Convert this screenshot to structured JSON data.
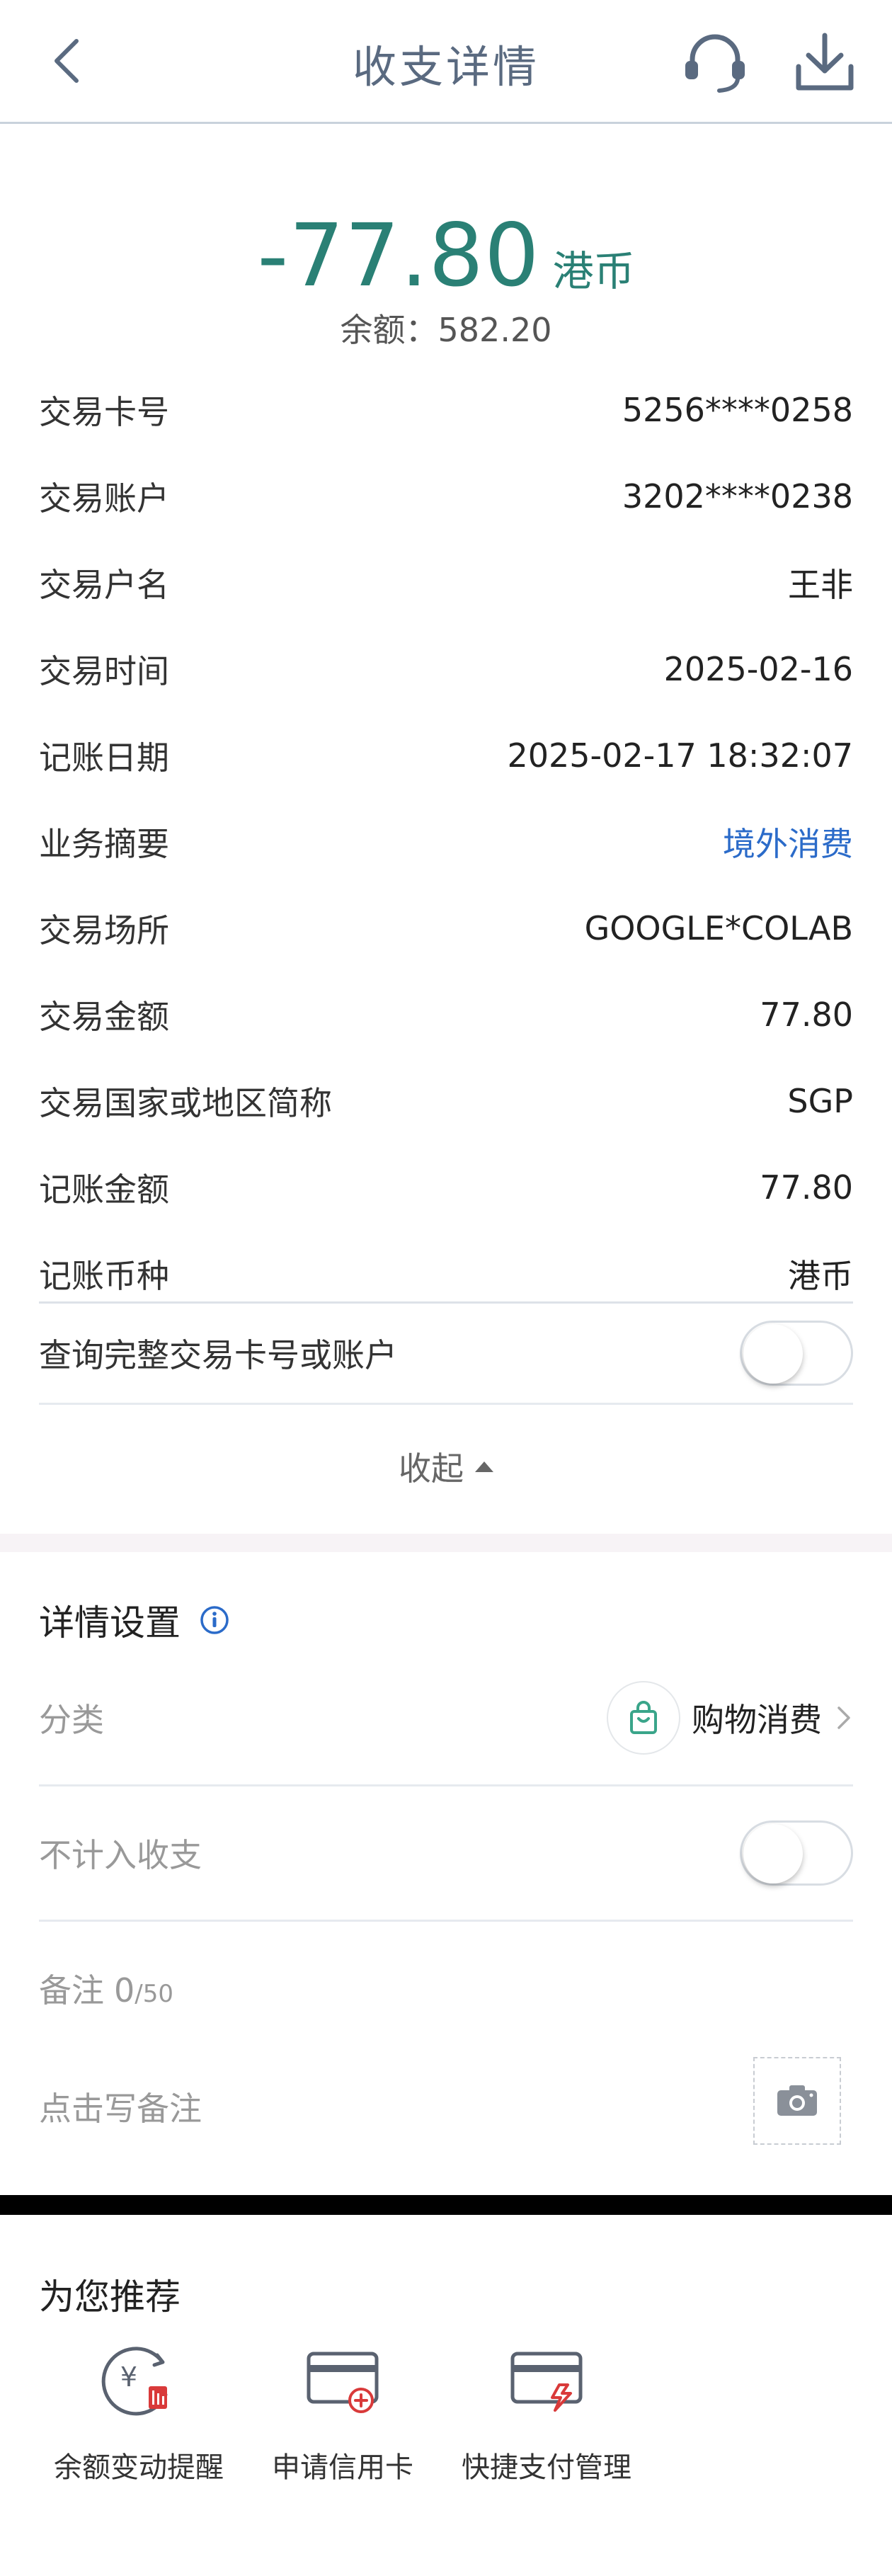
{
  "header": {
    "title": "收支详情",
    "back_icon": "chevron-left-icon",
    "service_icon": "headset-icon",
    "download_icon": "download-icon"
  },
  "summary": {
    "amount": "-77.80",
    "currency": "港币",
    "balance": "余额：582.20"
  },
  "details": [
    {
      "label": "交易卡号",
      "value": "5256****0258"
    },
    {
      "label": "交易账户",
      "value": "3202****0238"
    },
    {
      "label": "交易户名",
      "value": "王非"
    },
    {
      "label": "交易时间",
      "value": "2025-02-16"
    },
    {
      "label": "记账日期",
      "value": "2025-02-17 18:32:07"
    },
    {
      "label": "业务摘要",
      "value": "境外消费"
    },
    {
      "label": "交易场所",
      "value": "GOOGLE*COLAB"
    },
    {
      "label": "交易金额",
      "value": "77.80"
    },
    {
      "label": "交易国家或地区简称",
      "value": "SGP"
    },
    {
      "label": "记账金额",
      "value": "77.80"
    },
    {
      "label": "记账币种",
      "value": "港币"
    }
  ],
  "full_number_toggle": {
    "label": "查询完整交易卡号或账户",
    "on": false
  },
  "collapse_label": "收起",
  "settings": {
    "title": "详情设置",
    "category_label": "分类",
    "category_value": "购物消费",
    "exclude_label": "不计入收支",
    "exclude_on": false,
    "note_label": "备注",
    "note_count": "0",
    "note_max": "/50",
    "note_placeholder": "点击写备注"
  },
  "recommend": {
    "title": "为您推荐",
    "items": [
      {
        "label": "余额变动提醒",
        "icon": "balance-alert-icon"
      },
      {
        "label": "申请信用卡",
        "icon": "credit-card-add-icon"
      },
      {
        "label": "快捷支付管理",
        "icon": "quick-pay-card-icon"
      }
    ]
  },
  "colors": {
    "accent": "#2a8075",
    "link": "#2b6bc9",
    "category_icon": "#3aa58a",
    "recommend_badge": "#d93a3a"
  }
}
